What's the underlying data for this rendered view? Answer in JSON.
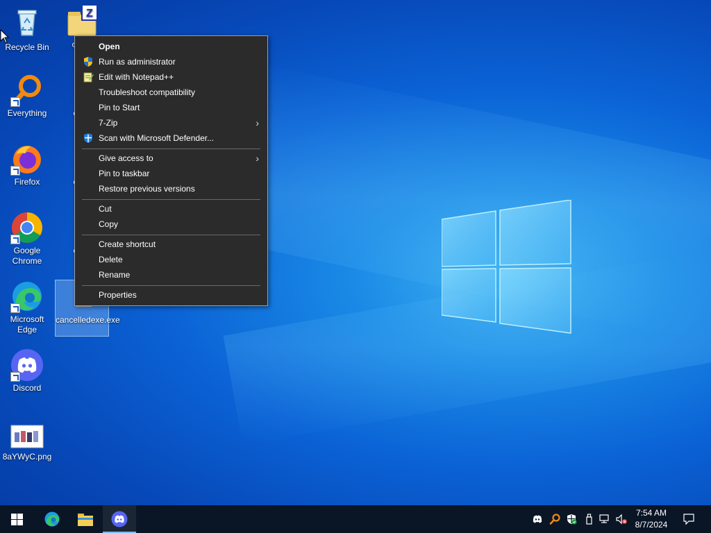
{
  "desktop": {
    "icons": [
      {
        "name": "recycle-bin",
        "label": "Recycle Bin"
      },
      {
        "name": "calub-archive",
        "label": "calub"
      },
      {
        "name": "everything",
        "label": "Everything"
      },
      {
        "name": "cance-1",
        "label": "canc"
      },
      {
        "name": "firefox",
        "label": "Firefox"
      },
      {
        "name": "cance-2",
        "label": "canc"
      },
      {
        "name": "google-chrome",
        "label": "Google Chrome"
      },
      {
        "name": "cance-3",
        "label": "canc"
      },
      {
        "name": "microsoft-edge",
        "label": "Microsoft Edge"
      },
      {
        "name": "cancelledexe",
        "label": "cancelledexe.exe"
      },
      {
        "name": "discord",
        "label": "Discord"
      },
      {
        "name": "png-file",
        "label": "8aYWyC.png"
      }
    ]
  },
  "context_menu": {
    "items": [
      {
        "label": "Open"
      },
      {
        "label": "Run as administrator",
        "icon": "uac-shield-icon"
      },
      {
        "label": "Edit with Notepad++",
        "icon": "notepadpp-icon"
      },
      {
        "label": "Troubleshoot compatibility"
      },
      {
        "label": "Pin to Start"
      },
      {
        "label": "7-Zip",
        "submenu": true
      },
      {
        "label": "Scan with Microsoft Defender...",
        "icon": "defender-icon"
      },
      {
        "label": "Give access to",
        "submenu": true
      },
      {
        "label": "Pin to taskbar"
      },
      {
        "label": "Restore previous versions"
      },
      {
        "label": "Cut"
      },
      {
        "label": "Copy"
      },
      {
        "label": "Create shortcut"
      },
      {
        "label": "Delete"
      },
      {
        "label": "Rename"
      },
      {
        "label": "Properties"
      }
    ],
    "submenu_arrow": "›"
  },
  "taskbar": {
    "pinned": [
      "start-button",
      "edge",
      "file-explorer",
      "discord"
    ],
    "tray_icons": [
      "discord-tray-icon",
      "everything-tray-icon",
      "defender-tray-icon",
      "usb-tray-icon",
      "network-tray-icon",
      "volume-muted-tray-icon"
    ],
    "time": "7:54 AM",
    "date": "8/7/2024"
  },
  "colors": {
    "menu_bg": "#2b2b2b",
    "taskbar_bg": "#0a1626",
    "accent": "#0078d7"
  }
}
